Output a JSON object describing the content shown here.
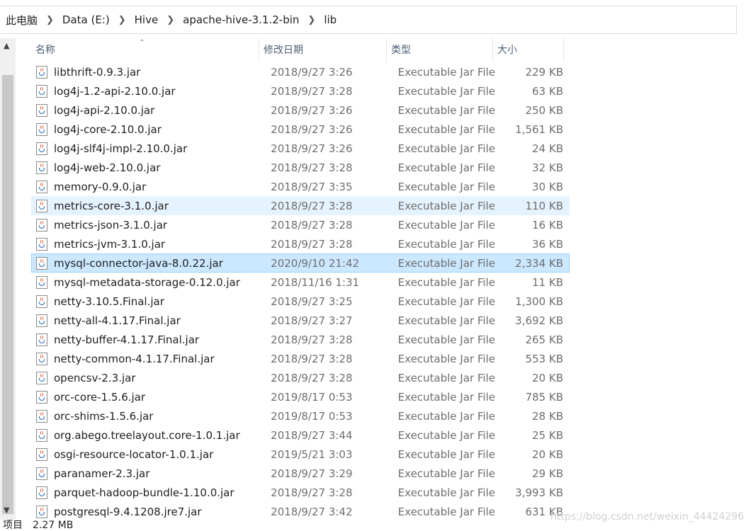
{
  "breadcrumb": [
    "此电脑",
    "Data (E:)",
    "Hive",
    "apache-hive-3.1.2-bin",
    "lib"
  ],
  "icons": {
    "separator": "chevron-right-icon",
    "file": "java-jar-icon",
    "scroll_up": "arrow-up-icon",
    "sort": "sort-ascending-icon"
  },
  "columns": {
    "name": "名称",
    "date": "修改日期",
    "type": "类型",
    "size": "大小"
  },
  "files": [
    {
      "name": "libthrift-0.9.3.jar",
      "date": "2018/9/27 3:26",
      "type": "Executable Jar File",
      "size": "229 KB"
    },
    {
      "name": "log4j-1.2-api-2.10.0.jar",
      "date": "2018/9/27 3:28",
      "type": "Executable Jar File",
      "size": "63 KB"
    },
    {
      "name": "log4j-api-2.10.0.jar",
      "date": "2018/9/27 3:26",
      "type": "Executable Jar File",
      "size": "250 KB"
    },
    {
      "name": "log4j-core-2.10.0.jar",
      "date": "2018/9/27 3:26",
      "type": "Executable Jar File",
      "size": "1,561 KB"
    },
    {
      "name": "log4j-slf4j-impl-2.10.0.jar",
      "date": "2018/9/27 3:26",
      "type": "Executable Jar File",
      "size": "24 KB"
    },
    {
      "name": "log4j-web-2.10.0.jar",
      "date": "2018/9/27 3:28",
      "type": "Executable Jar File",
      "size": "32 KB"
    },
    {
      "name": "memory-0.9.0.jar",
      "date": "2018/9/27 3:35",
      "type": "Executable Jar File",
      "size": "30 KB"
    },
    {
      "name": "metrics-core-3.1.0.jar",
      "date": "2018/9/27 3:28",
      "type": "Executable Jar File",
      "size": "110 KB",
      "state": "hover"
    },
    {
      "name": "metrics-json-3.1.0.jar",
      "date": "2018/9/27 3:28",
      "type": "Executable Jar File",
      "size": "16 KB"
    },
    {
      "name": "metrics-jvm-3.1.0.jar",
      "date": "2018/9/27 3:28",
      "type": "Executable Jar File",
      "size": "36 KB"
    },
    {
      "name": "mysql-connector-java-8.0.22.jar",
      "date": "2020/9/10 21:42",
      "type": "Executable Jar File",
      "size": "2,334 KB",
      "state": "selected"
    },
    {
      "name": "mysql-metadata-storage-0.12.0.jar",
      "date": "2018/11/16 1:31",
      "type": "Executable Jar File",
      "size": "11 KB"
    },
    {
      "name": "netty-3.10.5.Final.jar",
      "date": "2018/9/27 3:25",
      "type": "Executable Jar File",
      "size": "1,300 KB"
    },
    {
      "name": "netty-all-4.1.17.Final.jar",
      "date": "2018/9/27 3:27",
      "type": "Executable Jar File",
      "size": "3,692 KB"
    },
    {
      "name": "netty-buffer-4.1.17.Final.jar",
      "date": "2018/9/27 3:28",
      "type": "Executable Jar File",
      "size": "265 KB"
    },
    {
      "name": "netty-common-4.1.17.Final.jar",
      "date": "2018/9/27 3:28",
      "type": "Executable Jar File",
      "size": "553 KB"
    },
    {
      "name": "opencsv-2.3.jar",
      "date": "2018/9/27 3:28",
      "type": "Executable Jar File",
      "size": "20 KB"
    },
    {
      "name": "orc-core-1.5.6.jar",
      "date": "2019/8/17 0:53",
      "type": "Executable Jar File",
      "size": "785 KB"
    },
    {
      "name": "orc-shims-1.5.6.jar",
      "date": "2019/8/17 0:53",
      "type": "Executable Jar File",
      "size": "28 KB"
    },
    {
      "name": "org.abego.treelayout.core-1.0.1.jar",
      "date": "2018/9/27 3:44",
      "type": "Executable Jar File",
      "size": "25 KB"
    },
    {
      "name": "osgi-resource-locator-1.0.1.jar",
      "date": "2019/5/21 3:03",
      "type": "Executable Jar File",
      "size": "20 KB"
    },
    {
      "name": "paranamer-2.3.jar",
      "date": "2018/9/27 3:29",
      "type": "Executable Jar File",
      "size": "29 KB"
    },
    {
      "name": "parquet-hadoop-bundle-1.10.0.jar",
      "date": "2018/9/27 3:28",
      "type": "Executable Jar File",
      "size": "3,993 KB"
    },
    {
      "name": "postgresql-9.4.1208.jre7.jar",
      "date": "2018/9/27 3:42",
      "type": "Executable Jar File",
      "size": "631 KB"
    }
  ],
  "status": {
    "count": "项目",
    "selection_size": "2.27 MB"
  },
  "watermark": "https://blog.csdn.net/weixin_44424296"
}
